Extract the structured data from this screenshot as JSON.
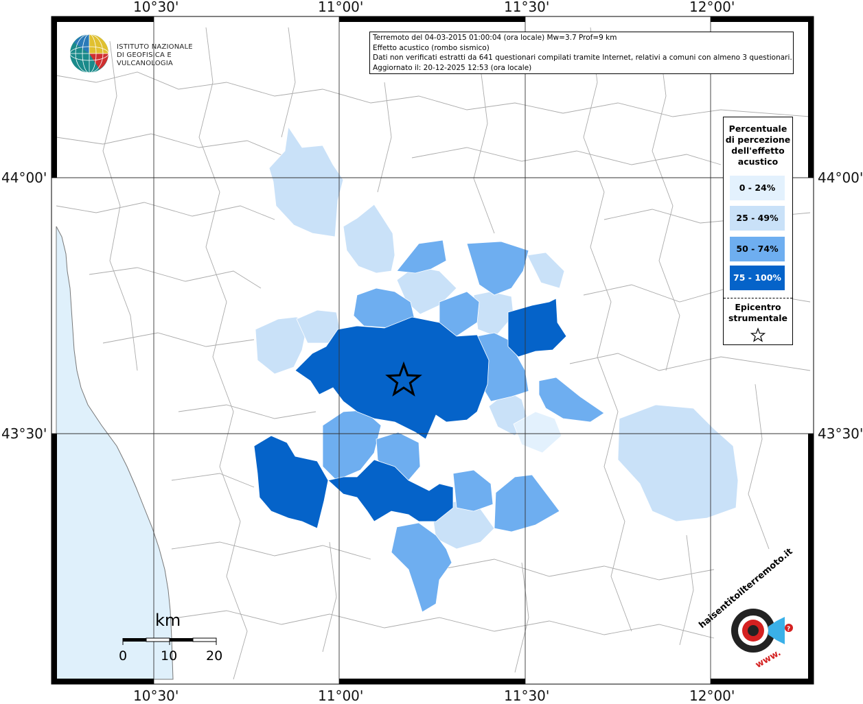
{
  "info": {
    "line1": "Terremoto del 04-03-2015 01:00:04 (ora locale) Mw=3.7 Prof=9 km",
    "line2": "Effetto acustico (rombo sismico)",
    "line3": "Dati non verificati estratti da 641 questionari compilati tramite Internet, relativi a comuni con almeno 3 questionari.",
    "line4": "Aggiornato il: 20-12-2025 12:53 (ora locale)"
  },
  "axes": {
    "top": [
      "10°30'",
      "11°00'",
      "11°30'",
      "12°00'"
    ],
    "bottom": [
      "10°30'",
      "11°00'",
      "11°30'",
      "12°00'"
    ],
    "left": [
      "44°00'",
      "43°30'"
    ],
    "right": [
      "44°00'",
      "43°30'"
    ]
  },
  "legend": {
    "title": "Percentuale di percezione dell'effetto acustico",
    "title_lines": [
      "Percentuale",
      "di percezione",
      "dell'effetto",
      "acustico"
    ],
    "classes": [
      {
        "label": "0 - 24%",
        "color": "#e3f1fd"
      },
      {
        "label": "25 - 49%",
        "color": "#c9e1f8"
      },
      {
        "label": "50 - 74%",
        "color": "#6eaef0"
      },
      {
        "label": "75 - 100%",
        "color": "#0563c9"
      }
    ],
    "epicenter_lines": [
      "Epicentro",
      "strumentale"
    ]
  },
  "scale": {
    "unit": "km",
    "labels": [
      "0",
      "10",
      "20"
    ]
  },
  "logo": {
    "line1": "ISTITUTO NAZIONALE",
    "line2": "DI GEOFISICA E VULCANOLOGIA"
  },
  "brand": {
    "text": "haisentitoilterremoto.it",
    "web": "www."
  },
  "colors": {
    "sea": "#dff0fb",
    "land": "#ffffff",
    "border": "#999999",
    "grid": "#333333"
  }
}
